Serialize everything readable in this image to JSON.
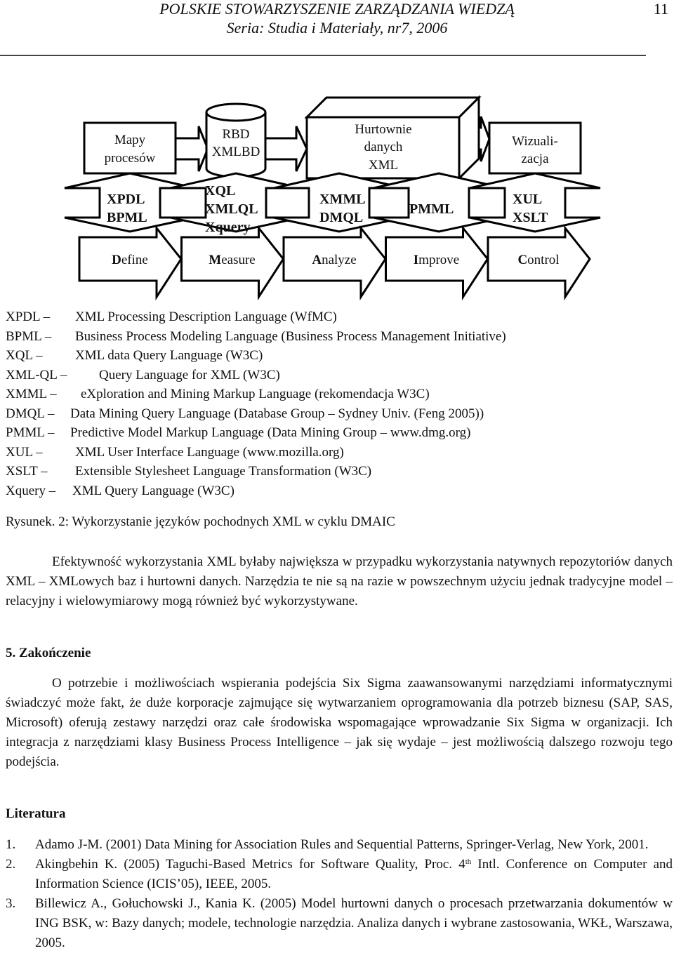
{
  "header": {
    "journal": "POLSKIE STOWARZYSZENIE ZARZĄDZANIA WIEDZĄ",
    "series": "Seria: Studia i Materiały, nr7, 2006",
    "page_number": "11"
  },
  "diagram": {
    "top_boxes": [
      {
        "lines": [
          "Mapy",
          "procesów"
        ],
        "shape": "rectangle"
      },
      {
        "lines": [
          "RBD",
          "XMLBD"
        ],
        "shape": "cylinder"
      },
      {
        "lines": [
          "Hurtownie",
          "danych",
          "XML"
        ],
        "shape": "3d-box"
      },
      {
        "lines": [
          "Wizuali-",
          "zacja"
        ],
        "shape": "rectangle"
      }
    ],
    "languages": [
      {
        "lines": [
          "XPDL",
          "BPML"
        ]
      },
      {
        "lines": [
          "XQL",
          "XMLQL",
          "Xquery"
        ]
      },
      {
        "lines": [
          "XMML",
          "DMQL"
        ]
      },
      {
        "lines": [
          "PMML"
        ]
      },
      {
        "lines": [
          "XUL",
          "XSLT"
        ]
      }
    ],
    "dmaic": [
      {
        "initial": "D",
        "rest": "efine"
      },
      {
        "initial": "M",
        "rest": "easure"
      },
      {
        "initial": "A",
        "rest": "nalyze"
      },
      {
        "initial": "I",
        "rest": "mprove"
      },
      {
        "initial": "C",
        "rest": "ontrol"
      }
    ]
  },
  "abbreviations": [
    {
      "abbr": "XPDL –",
      "desc": "XML Processing Description Language (WfMC)"
    },
    {
      "abbr": "BPML –",
      "desc": "Business Process Modeling Language (Business Process Management Initiative)"
    },
    {
      "abbr": "XQL –",
      "desc": "XML data Query Language (W3C)"
    },
    {
      "abbr": "XML-QL –",
      "desc": "Query Language for XML (W3C)"
    },
    {
      "abbr": "XMML –",
      "desc": "eXploration and Mining Markup Language (rekomendacja W3C)"
    },
    {
      "abbr": "DMQL –",
      "desc": "Data Mining Query Language (Database Group – Sydney Univ. (Feng 2005))"
    },
    {
      "abbr": "PMML –",
      "desc": "Predictive Model Markup Language (Data Mining Group – www.dmg.org)"
    },
    {
      "abbr": "XUL –",
      "desc": "XML User Interface Language (www.mozilla.org)"
    },
    {
      "abbr": "XSLT –",
      "desc": "Extensible Stylesheet Language Transformation (W3C)"
    },
    {
      "abbr": "Xquery –",
      "desc": "XML Query Language (W3C)"
    }
  ],
  "caption": "Rysunek. 2: Wykorzystanie języków pochodnych XML w cyklu DMAIC",
  "paragraph1": "Efektywność wykorzystania XML byłaby największa w przypadku wykorzystania natywnych repozytoriów danych XML – XMLowych baz i hurtowni danych. Narzędzia te nie są na razie w powszechnym użyciu jednak tradycyjne model – relacyjny i wielowymiarowy mogą również być wykorzystywane.",
  "section_title": "5. Zakończenie",
  "paragraph2": "O potrzebie i możliwościach wspierania podejścia Six Sigma zaawansowanymi narzędziami informatycznymi świadczyć może fakt, że duże korporacje zajmujące się wytwarzaniem oprogramowania dla potrzeb biznesu (SAP, SAS, Microsoft) oferują zestawy narzędzi oraz całe środowiska wspomagające wprowadzanie Six Sigma w organizacji. Ich integracja z narzędziami klasy Business Process Intelligence – jak się wydaje – jest możliwością dalszego rozwoju tego podejścia.",
  "literature_title": "Literatura",
  "references": [
    {
      "num": "1.",
      "text": "Adamo J-M. (2001) Data Mining for Association Rules and Sequential Patterns, Springer-Verlag, New York, 2001."
    },
    {
      "num": "2.",
      "text_before": "Akingbehin K. (2005) Taguchi-Based Metrics for Software Quality, Proc. 4",
      "sup": "th",
      "text_after": " Intl. Conference on Computer and Information Science (ICIS’05), IEEE, 2005."
    },
    {
      "num": "3.",
      "text": "Billewicz A., Gołuchowski J., Kania K. (2005) Model hurtowni danych o procesach przetwarzania dokumentów w ING BSK, w: Bazy danych; modele, technologie narzędzia. Analiza danych i wybrane zastosowania, WKŁ, Warszawa, 2005."
    }
  ]
}
